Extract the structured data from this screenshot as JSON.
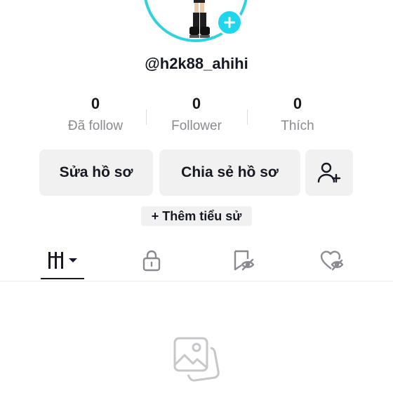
{
  "profile": {
    "username": "@h2k88_ahihi"
  },
  "stats": [
    {
      "value": "0",
      "label": "Đã follow"
    },
    {
      "value": "0",
      "label": "Follower"
    },
    {
      "value": "0",
      "label": "Thích"
    }
  ],
  "actions": {
    "edit_profile": "Sửa hồ sơ",
    "share_profile": "Chia sẻ hồ sơ"
  },
  "bio": {
    "add_bio": "+ Thêm tiểu sử"
  },
  "tabs": [
    {
      "icon": "videos-grid-icon",
      "active": true
    },
    {
      "icon": "lock-icon",
      "active": false
    },
    {
      "icon": "bookmark-icon",
      "active": false
    },
    {
      "icon": "liked-heart-icon",
      "active": false
    }
  ],
  "colors": {
    "accent": "#20d5ec",
    "ring": "#2fd3dd",
    "text": "#161823",
    "muted": "#8a8b91",
    "button_bg": "#f1f1f2"
  }
}
